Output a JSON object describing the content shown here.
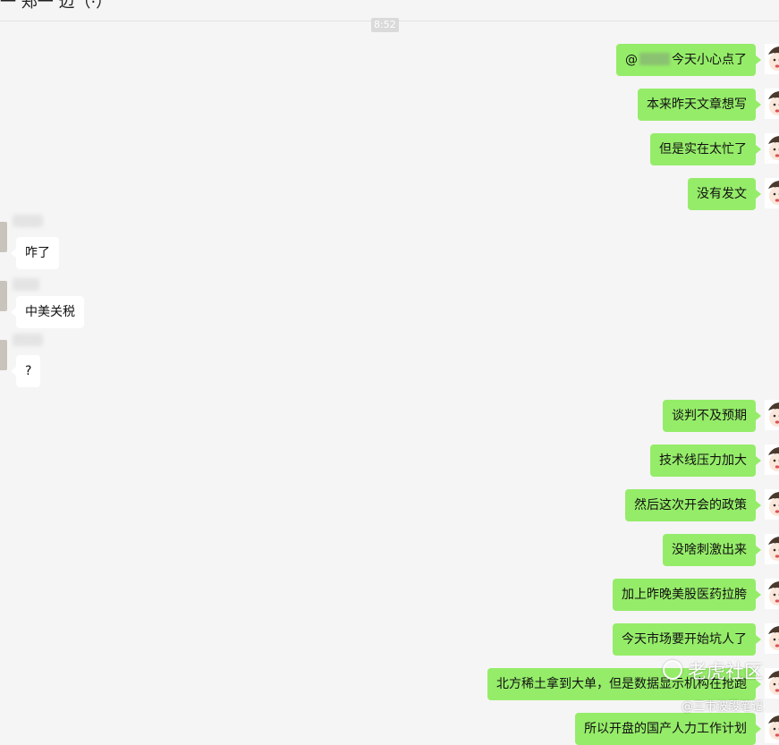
{
  "header": {
    "title": "一 郑一 迈（·）"
  },
  "timestamp": "8:52",
  "messages": [
    {
      "dir": "out",
      "text": "今天小心点了",
      "prefix": "@"
    },
    {
      "dir": "out",
      "text": "本来昨天文章想写"
    },
    {
      "dir": "out",
      "text": "但是实在太忙了"
    },
    {
      "dir": "out",
      "text": "没有发文"
    },
    {
      "dir": "in",
      "text": "咋了"
    },
    {
      "dir": "in",
      "text": "中美关税"
    },
    {
      "dir": "in",
      "text": "?"
    },
    {
      "dir": "out",
      "text": "谈判不及预期"
    },
    {
      "dir": "out",
      "text": "技术线压力加大"
    },
    {
      "dir": "out",
      "text": "然后这次开会的政策"
    },
    {
      "dir": "out",
      "text": "没啥刺激出来"
    },
    {
      "dir": "out",
      "text": "加上昨晚美股医药拉胯"
    },
    {
      "dir": "out",
      "text": "今天市场要开始坑人了"
    },
    {
      "dir": "out",
      "text": "北方稀土拿到大单，但是数据显示机构在抢跑"
    },
    {
      "dir": "out",
      "text": "所以开盘的国产人力工作计划"
    }
  ],
  "watermark": {
    "main": "老虎社区",
    "sub": "@三市波段笔记"
  },
  "icons": {
    "self_avatar": "cartoon-boy-avatar-icon",
    "other_avatar": "user-avatar-icon"
  },
  "colors": {
    "outgoing_bubble": "#95ec69",
    "incoming_bubble": "#ffffff",
    "background": "#f5f5f5"
  }
}
